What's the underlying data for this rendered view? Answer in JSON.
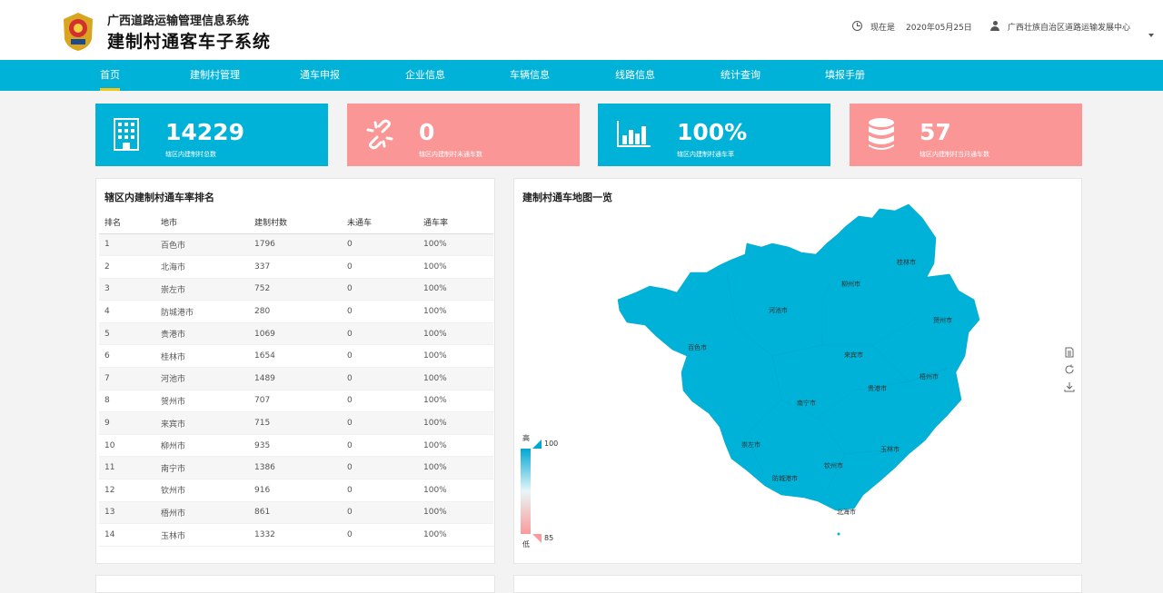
{
  "header": {
    "system_title": "广西道路运输管理信息系统",
    "subsystem_title": "建制村通客车子系统",
    "now_label": "现在是",
    "date": "2020年05月25日",
    "user": "广西壮族自治区道路运输发展中心"
  },
  "nav": {
    "items": [
      "首页",
      "建制村管理",
      "通车申报",
      "企业信息",
      "车辆信息",
      "线路信息",
      "统计查询",
      "填报手册"
    ]
  },
  "stats": [
    {
      "value": "14229",
      "label": "辖区内建制村总数",
      "icon": "building-icon"
    },
    {
      "value": "0",
      "label": "辖区内建制村未通车数",
      "icon": "broken-link-icon"
    },
    {
      "value": "100%",
      "label": "辖区内建制村通车率",
      "icon": "bar-chart-icon"
    },
    {
      "value": "57",
      "label": "辖区内建制村当月通车数",
      "icon": "database-icon"
    }
  ],
  "ranking": {
    "title": "辖区内建制村通车率排名",
    "columns": [
      "排名",
      "地市",
      "建制村数",
      "未通车",
      "通车率"
    ],
    "rows": [
      [
        "1",
        "百色市",
        "1796",
        "0",
        "100%"
      ],
      [
        "2",
        "北海市",
        "337",
        "0",
        "100%"
      ],
      [
        "3",
        "崇左市",
        "752",
        "0",
        "100%"
      ],
      [
        "4",
        "防城港市",
        "280",
        "0",
        "100%"
      ],
      [
        "5",
        "贵港市",
        "1069",
        "0",
        "100%"
      ],
      [
        "6",
        "桂林市",
        "1654",
        "0",
        "100%"
      ],
      [
        "7",
        "河池市",
        "1489",
        "0",
        "100%"
      ],
      [
        "8",
        "贺州市",
        "707",
        "0",
        "100%"
      ],
      [
        "9",
        "来宾市",
        "715",
        "0",
        "100%"
      ],
      [
        "10",
        "柳州市",
        "935",
        "0",
        "100%"
      ],
      [
        "11",
        "南宁市",
        "1386",
        "0",
        "100%"
      ],
      [
        "12",
        "钦州市",
        "916",
        "0",
        "100%"
      ],
      [
        "13",
        "梧州市",
        "861",
        "0",
        "100%"
      ],
      [
        "14",
        "玉林市",
        "1332",
        "0",
        "100%"
      ]
    ]
  },
  "map": {
    "title": "建制村通车地图一览",
    "fill_color": "#00b2d8",
    "cities": [
      "桂林市",
      "柳州市",
      "河池市",
      "贺州市",
      "百色市",
      "来宾市",
      "梧州市",
      "贵港市",
      "南宁市",
      "崇左市",
      "玉林市",
      "钦州市",
      "防城港市",
      "北海市"
    ],
    "legend": {
      "high_label": "高",
      "low_label": "低",
      "max": "100",
      "min": "85"
    }
  },
  "colors": {
    "primary": "#00b2d8",
    "pink": "#fa9696",
    "active_underline": "#f5c518"
  }
}
